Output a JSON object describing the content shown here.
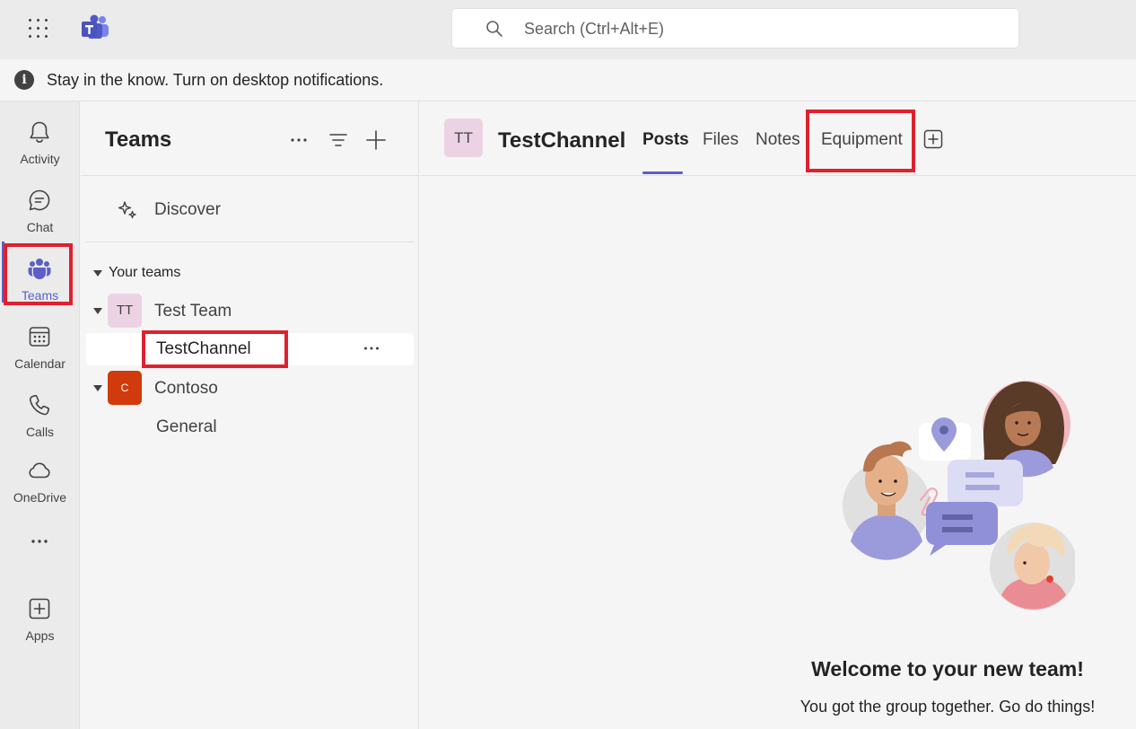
{
  "topbar": {
    "search": {
      "placeholder": "Search (Ctrl+Alt+E)",
      "icon": "search-icon"
    },
    "app_launcher_icon": "waffle-icon",
    "logo_icon": "teams-logo-icon"
  },
  "notice": {
    "icon": "info-icon",
    "text": "Stay in the know. Turn on desktop notifications."
  },
  "rail": {
    "items": [
      {
        "label": "Activity",
        "icon": "bell-icon"
      },
      {
        "label": "Chat",
        "icon": "chat-icon"
      },
      {
        "label": "Teams",
        "icon": "teams-icon",
        "active": true
      },
      {
        "label": "Calendar",
        "icon": "calendar-icon"
      },
      {
        "label": "Calls",
        "icon": "phone-icon"
      },
      {
        "label": "OneDrive",
        "icon": "cloud-icon"
      },
      {
        "label": "",
        "icon": "more-icon"
      },
      {
        "label": "Apps",
        "icon": "add-app-icon"
      }
    ]
  },
  "panel": {
    "title": "Teams",
    "discover_label": "Discover",
    "section_label": "Your teams",
    "teams": [
      {
        "name": "Test Team",
        "initials": "TT",
        "avatar_bg": "#ecd3e4",
        "avatar_fg": "#424242",
        "channels": [
          {
            "name": "TestChannel",
            "selected": true
          }
        ]
      },
      {
        "name": "Contoso",
        "initials": "C",
        "avatar_bg": "#d13a0c",
        "avatar_fg": "#ffffff",
        "channels": [
          {
            "name": "General"
          }
        ]
      }
    ]
  },
  "main": {
    "channel_initials": "TT",
    "channel_name": "TestChannel",
    "tabs": [
      {
        "label": "Posts",
        "active": true
      },
      {
        "label": "Files"
      },
      {
        "label": "Notes"
      },
      {
        "label": "Equipment"
      }
    ],
    "welcome_title": "Welcome to your new team!",
    "welcome_subtitle": "You got the group together. Go do things!"
  },
  "colors": {
    "accent": "#5b5fc7",
    "highlight_box": "#e0202d",
    "rail_bg": "#ebebeb",
    "panel_bg": "#f5f5f5"
  }
}
